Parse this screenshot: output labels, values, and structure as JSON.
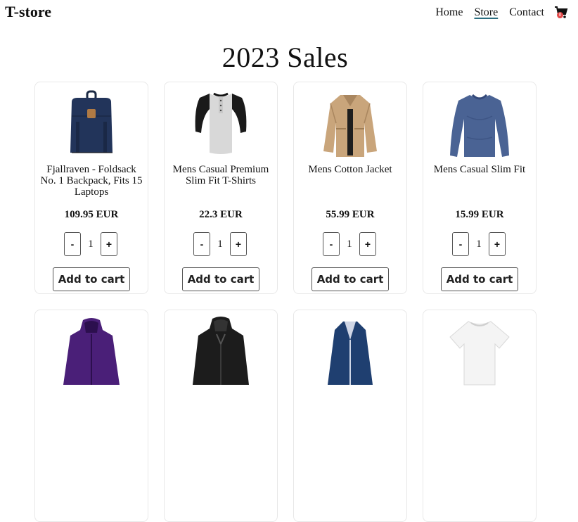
{
  "brand": "T-store",
  "nav": {
    "items": [
      "Home",
      "Store",
      "Contact"
    ],
    "active": "Store",
    "cart_icon": "cart-icon",
    "cart_badge": "0"
  },
  "page_title": "2023 Sales",
  "add_to_cart_label": "Add to cart",
  "minus_label": "-",
  "plus_label": "+",
  "products": [
    {
      "title": "Fjallraven - Foldsack No. 1 Backpack, Fits 15 Laptops",
      "price": "109.95 EUR",
      "qty": "1",
      "image": "backpack-navy"
    },
    {
      "title": "Mens Casual Premium Slim Fit T-Shirts",
      "price": "22.3 EUR",
      "qty": "1",
      "image": "raglan-tshirt-black-gray"
    },
    {
      "title": "Mens Cotton Jacket",
      "price": "55.99 EUR",
      "qty": "1",
      "image": "cotton-jacket-khaki"
    },
    {
      "title": "Mens Casual Slim Fit",
      "price": "15.99 EUR",
      "qty": "1",
      "image": "longsleeve-blue"
    },
    {
      "title": "",
      "price": "",
      "qty": "",
      "image": "jacket-purple"
    },
    {
      "title": "",
      "price": "",
      "qty": "",
      "image": "leather-jacket-black"
    },
    {
      "title": "",
      "price": "",
      "qty": "",
      "image": "raincoat-navy"
    },
    {
      "title": "",
      "price": "",
      "qty": "",
      "image": "tshirt-white"
    }
  ],
  "colors": {
    "card_border": "#e8e8e8",
    "button_border": "#555555",
    "badge": "#e34a4a",
    "active_underline": "#2d6e80"
  }
}
